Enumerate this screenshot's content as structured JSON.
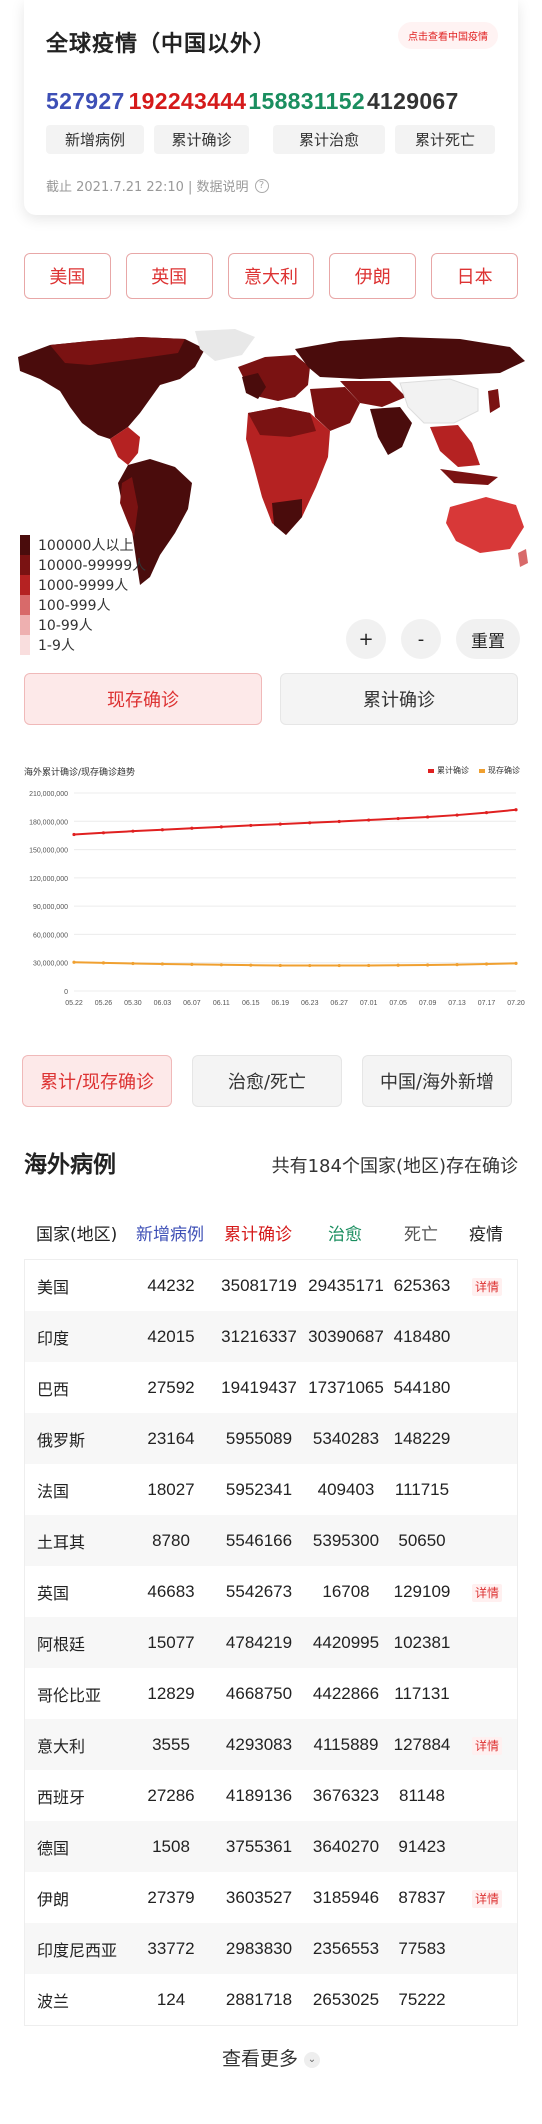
{
  "summary": {
    "title": "全球疫情（中国以外）",
    "china_link": "点击查看中国疫情",
    "new_cases": "527927",
    "total_confirmed": "192243444",
    "total_cured": "158831152",
    "total_dead": "4129067",
    "labels": {
      "new": "新增病例",
      "confirmed": "累计确诊",
      "cured": "累计治愈",
      "dead": "累计死亡"
    },
    "updated": "截止 2021.7.21 22:10 | 数据说明",
    "help_icon": "?"
  },
  "countries": [
    "美国",
    "英国",
    "意大利",
    "伊朗",
    "日本"
  ],
  "map": {
    "legend": [
      {
        "label": "100000人以上",
        "color": "#4a0c0c"
      },
      {
        "label": "10000-99999人",
        "color": "#7a1212"
      },
      {
        "label": "1000-9999人",
        "color": "#b52222"
      },
      {
        "label": "100-999人",
        "color": "#d86a6a"
      },
      {
        "label": "10-99人",
        "color": "#eeb0b0"
      },
      {
        "label": "1-9人",
        "color": "#f9dede"
      }
    ],
    "zoom_in": "+",
    "zoom_out": "-",
    "reset": "重置"
  },
  "mode_tabs": {
    "current": "现存确诊",
    "cumulative": "累计确诊"
  },
  "chart_data": {
    "type": "line",
    "title": "海外累计确诊/现存确诊趋势",
    "x": [
      "05.22",
      "05.26",
      "05.30",
      "06.03",
      "06.07",
      "06.11",
      "06.15",
      "06.19",
      "06.23",
      "06.27",
      "07.01",
      "07.05",
      "07.09",
      "07.13",
      "07.17",
      "07.20"
    ],
    "series": [
      {
        "name": "累计确诊",
        "color": "#e02020",
        "values": [
          166000000,
          167800000,
          169500000,
          171000000,
          172600000,
          174100000,
          175600000,
          177000000,
          178400000,
          179800000,
          181300000,
          182900000,
          184600000,
          186600000,
          189200000,
          192200000
        ]
      },
      {
        "name": "现存确诊",
        "color": "#f0a030",
        "values": [
          30500000,
          29800000,
          29200000,
          28700000,
          28200000,
          27800000,
          27400000,
          27100000,
          27000000,
          27000000,
          27100000,
          27300000,
          27600000,
          28000000,
          28600000,
          29300000
        ]
      }
    ],
    "yticks": [
      "0",
      "30,000,000",
      "60,000,000",
      "90,000,000",
      "120,000,000",
      "150,000,000",
      "180,000,000",
      "210,000,000"
    ],
    "ylim": [
      0,
      210000000
    ],
    "legend": "top-right",
    "grid": true
  },
  "chart_tabs": [
    "累计/现存确诊",
    "治愈/死亡",
    "中国/海外新增"
  ],
  "table": {
    "title": "海外病例",
    "subtitle": "共有184个国家(地区)存在确诊",
    "headers": [
      "国家(地区)",
      "新增病例",
      "累计确诊",
      "治愈",
      "死亡",
      "疫情"
    ],
    "detail_label": "详情",
    "rows": [
      {
        "country": "美国",
        "new": "44232",
        "confirmed": "35081719",
        "cured": "29435171",
        "dead": "625363",
        "detail": true
      },
      {
        "country": "印度",
        "new": "42015",
        "confirmed": "31216337",
        "cured": "30390687",
        "dead": "418480",
        "detail": false
      },
      {
        "country": "巴西",
        "new": "27592",
        "confirmed": "19419437",
        "cured": "17371065",
        "dead": "544180",
        "detail": false
      },
      {
        "country": "俄罗斯",
        "new": "23164",
        "confirmed": "5955089",
        "cured": "5340283",
        "dead": "148229",
        "detail": false
      },
      {
        "country": "法国",
        "new": "18027",
        "confirmed": "5952341",
        "cured": "409403",
        "dead": "111715",
        "detail": false
      },
      {
        "country": "土耳其",
        "new": "8780",
        "confirmed": "5546166",
        "cured": "5395300",
        "dead": "50650",
        "detail": false
      },
      {
        "country": "英国",
        "new": "46683",
        "confirmed": "5542673",
        "cured": "16708",
        "dead": "129109",
        "detail": true
      },
      {
        "country": "阿根廷",
        "new": "15077",
        "confirmed": "4784219",
        "cured": "4420995",
        "dead": "102381",
        "detail": false
      },
      {
        "country": "哥伦比亚",
        "new": "12829",
        "confirmed": "4668750",
        "cured": "4422866",
        "dead": "117131",
        "detail": false
      },
      {
        "country": "意大利",
        "new": "3555",
        "confirmed": "4293083",
        "cured": "4115889",
        "dead": "127884",
        "detail": true
      },
      {
        "country": "西班牙",
        "new": "27286",
        "confirmed": "4189136",
        "cured": "3676323",
        "dead": "81148",
        "detail": false
      },
      {
        "country": "德国",
        "new": "1508",
        "confirmed": "3755361",
        "cured": "3640270",
        "dead": "91423",
        "detail": false
      },
      {
        "country": "伊朗",
        "new": "27379",
        "confirmed": "3603527",
        "cured": "3185946",
        "dead": "87837",
        "detail": true
      },
      {
        "country": "印度尼西亚",
        "new": "33772",
        "confirmed": "2983830",
        "cured": "2356553",
        "dead": "77583",
        "detail": false
      },
      {
        "country": "波兰",
        "new": "124",
        "confirmed": "2881718",
        "cured": "2653025",
        "dead": "75222",
        "detail": false
      }
    ],
    "more": "查看更多"
  }
}
